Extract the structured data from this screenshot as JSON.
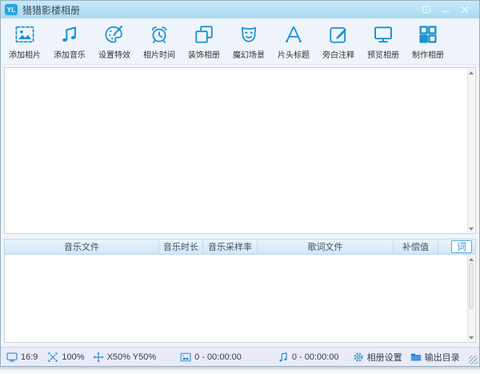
{
  "window": {
    "logo_text": "YL",
    "title": "猎猎影楼相册"
  },
  "toolbar": {
    "items": [
      {
        "label": "添加相片",
        "icon": "add-photo-icon"
      },
      {
        "label": "添加音乐",
        "icon": "add-music-icon"
      },
      {
        "label": "设置特效",
        "icon": "effects-icon"
      },
      {
        "label": "相片时间",
        "icon": "photo-time-icon"
      },
      {
        "label": "装饰相册",
        "icon": "decorate-album-icon"
      },
      {
        "label": "魔幻场景",
        "icon": "magic-scene-icon"
      },
      {
        "label": "片头标题",
        "icon": "intro-title-icon"
      },
      {
        "label": "旁白注释",
        "icon": "narration-icon"
      },
      {
        "label": "预览相册",
        "icon": "preview-album-icon"
      },
      {
        "label": "制作相册",
        "icon": "make-album-icon"
      }
    ]
  },
  "music_table": {
    "columns": [
      "音乐文件",
      "音乐时长",
      "音乐采样率",
      "歌词文件",
      "补偿值"
    ],
    "lyrics_button_label": "词",
    "rows": []
  },
  "status_bar": {
    "aspect_ratio": "16:9",
    "scale": "100%",
    "position": "X50% Y50%",
    "photos_duration": "0 - 00:00:00",
    "music_duration": "0 - 00:00:00",
    "album_settings_label": "相册设置",
    "output_dir_label": "输出目录"
  },
  "colors": {
    "accent_blue": "#1b92d0",
    "titlebar_blue": "#b5e0f3",
    "statusbar_bg": "#e9ecf8",
    "folder_blue": "#2e7fd6"
  }
}
